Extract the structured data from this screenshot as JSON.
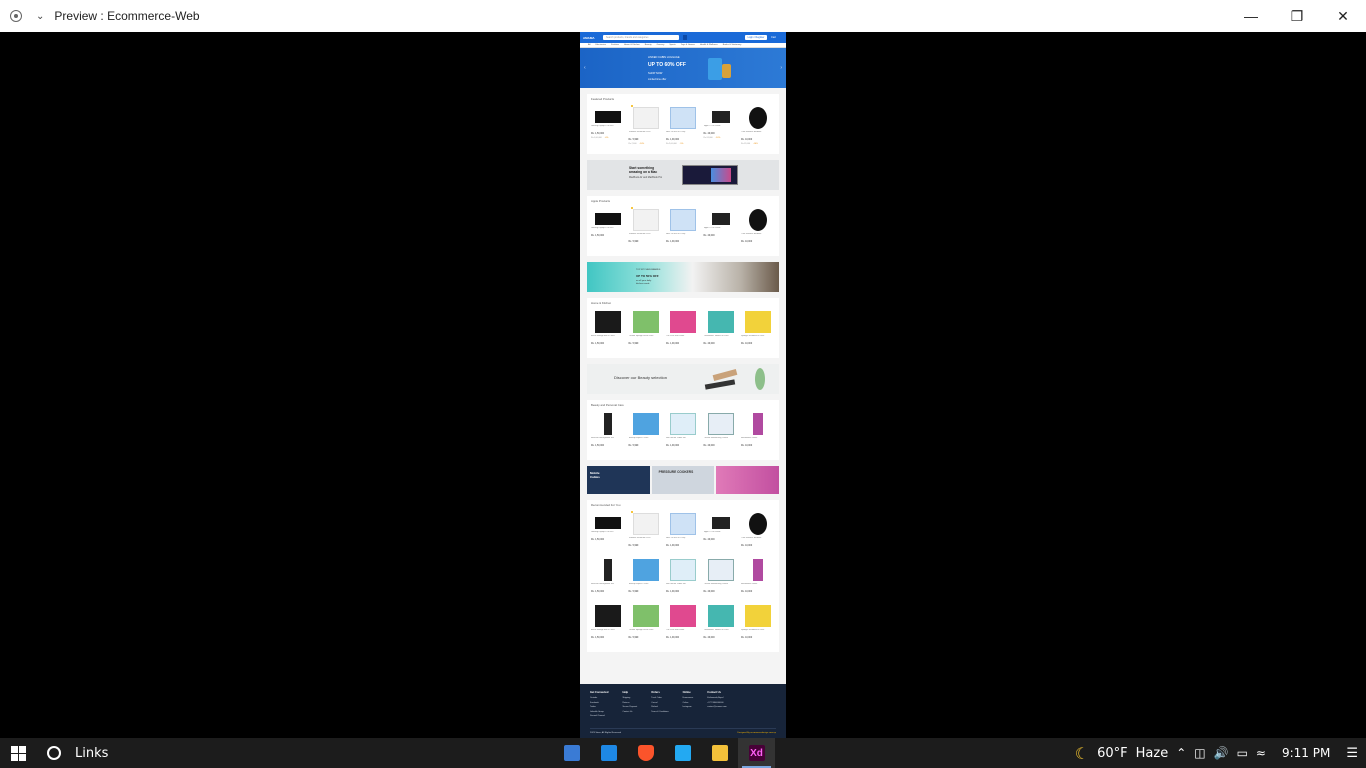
{
  "window": {
    "title": "Preview : Ecommerce-Web"
  },
  "site": {
    "logo": "AMAMA",
    "search_placeholder": "Search products, brands and categories",
    "login": "Login / Register",
    "cart": "Cart",
    "nav": [
      "All",
      "Electronics",
      "Fashion",
      "Home & Kitchen",
      "Beauty",
      "Grocery",
      "Sports",
      "Toys & Games",
      "Health & Wellness",
      "Books & Stationery"
    ],
    "hero": {
      "line1": "LINKED CABIN LUGGAGE",
      "line2": "UP TO 60% OFF",
      "line3": "SHOP NOW",
      "line4": "Limited time offer"
    },
    "sections": [
      {
        "title": "Featured Products",
        "rows": [
          [
            {
              "name": "Gaming Laptop 15.6 inch",
              "price": "Rs. 1,50,000",
              "old": "Rs.1,60,000",
              "off": "-6%"
            },
            {
              "name": "Wireless Router AC1200",
              "price": "Rs. 5,999",
              "old": "Rs.7,000",
              "off": "-14%"
            },
            {
              "name": "iMac 24 inch M1 Chip",
              "price": "Rs. 1,90,000",
              "old": "Rs.2,00,000",
              "off": "-5%"
            },
            {
              "name": "Apple TV 4K 64GB",
              "price": "Rs. 20,000",
              "old": "Rs.24,000",
              "off": "-16%"
            },
            {
              "name": "True Wireless Earbuds",
              "price": "Rs. 10,000",
              "old": "Rs.12,000",
              "off": "-16%"
            }
          ]
        ]
      },
      {
        "title": "Apple Products",
        "rows": [
          [
            {
              "name": "Gaming Laptop 15.6 inch",
              "price": "Rs. 1,50,000"
            },
            {
              "name": "Wireless Router AC1200",
              "price": "Rs. 5,999"
            },
            {
              "name": "iMac 24 inch M1 Chip",
              "price": "Rs. 1,90,000"
            },
            {
              "name": "Apple TV 4K 64GB",
              "price": "Rs. 20,000"
            },
            {
              "name": "True Wireless Earbuds",
              "price": "Rs. 10,000"
            }
          ]
        ]
      },
      {
        "title": "Home & Kitchen",
        "rows": [
          [
            {
              "name": "Black Storage Box 3 Piece",
              "price": "Rs. 1,50,000"
            },
            {
              "name": "Kitchen Sponge Scrub Pack",
              "price": "Rs. 5,999"
            },
            {
              "name": "The Pink Stuff Paste",
              "price": "Rs. 1,90,000"
            },
            {
              "name": "Dishwasher Tablets 40 Pack",
              "price": "Rs. 20,000"
            },
            {
              "name": "Sponge Scrubbers 6 Pack",
              "price": "Rs. 10,000"
            }
          ]
        ]
      },
      {
        "title": "Beauty and Personal Care",
        "rows": [
          [
            {
              "name": "Mascara and Eyeliner Set",
              "price": "Rs. 1,50,000"
            },
            {
              "name": "Makeup Wipes 3 Pack",
              "price": "Rs. 5,999"
            },
            {
              "name": "Hair Serum Tubes Set",
              "price": "Rs. 1,90,000"
            },
            {
              "name": "CeraVe Moisturising Cream",
              "price": "Rs. 20,000"
            },
            {
              "name": "Mouthwash 500ml",
              "price": "Rs. 10,000"
            }
          ]
        ]
      },
      {
        "title": "Recommended For You",
        "rows": [
          [
            {
              "name": "Gaming Laptop 15.6 inch",
              "price": "Rs. 1,50,000"
            },
            {
              "name": "Wireless Router AC1200",
              "price": "Rs. 5,999"
            },
            {
              "name": "iMac 24 inch M1 Chip",
              "price": "Rs. 1,90,000"
            },
            {
              "name": "Apple TV 4K 64GB",
              "price": "Rs. 20,000"
            },
            {
              "name": "True Wireless Earbuds",
              "price": "Rs. 10,000"
            }
          ],
          [
            {
              "name": "Mascara and Eyeliner Set",
              "price": "Rs. 1,50,000"
            },
            {
              "name": "Makeup Wipes 3 Pack",
              "price": "Rs. 5,999"
            },
            {
              "name": "Hair Serum Tubes Set",
              "price": "Rs. 1,90,000"
            },
            {
              "name": "CeraVe Moisturising Cream",
              "price": "Rs. 20,000"
            },
            {
              "name": "Mouthwash 500ml",
              "price": "Rs. 10,000"
            }
          ],
          [
            {
              "name": "Black Storage Box 3 Piece",
              "price": "Rs. 1,50,000"
            },
            {
              "name": "Kitchen Sponge Scrub Pack",
              "price": "Rs. 5,999"
            },
            {
              "name": "The Pink Stuff Paste",
              "price": "Rs. 1,90,000"
            },
            {
              "name": "Dishwasher Tablets 40 Pack",
              "price": "Rs. 20,000"
            },
            {
              "name": "Sponge Scrubbers 6 Pack",
              "price": "Rs. 10,000"
            }
          ]
        ]
      }
    ],
    "banner_mac": {
      "head1": "Start something",
      "head2": "amazing on a Mac",
      "sub": "MacBook Air and MacBook Pro"
    },
    "banner_kitchen": {
      "k1": "TOP KITCHEN BRANDS",
      "k2": "UP TO 50% OFF",
      "k3a": "on all your daily",
      "k3b": "kitchen needs"
    },
    "banner_beauty": {
      "text": "Discover our Beauty selection"
    },
    "tri": {
      "c1": "Mobile",
      "c1b": "Cables",
      "c2": "PRESSURE COOKERS"
    },
    "footer": {
      "cols": [
        {
          "h": "Get Connected",
          "items": [
            "Youtube",
            "Facebook",
            "Twitter",
            "LinkedIn Group",
            "Discord Channel"
          ]
        },
        {
          "h": "Help",
          "items": [
            "Shipping",
            "Returns",
            "Secure Payment",
            "Contact Us"
          ]
        },
        {
          "h": "Orders",
          "items": [
            "Track Order",
            "Cancel",
            "Refund",
            "Terms & Conditions"
          ]
        },
        {
          "h": "Online",
          "items": [
            "Ecommerce",
            "Online",
            "Instagram"
          ]
        },
        {
          "h": "Contact Us",
          "items": [
            "Kathmandu,Nepal",
            "+977 9800000000",
            "contact@ecomm.com"
          ]
        }
      ],
      "copy": "2023 Store, All Rights Reserved",
      "credit_prefix": "Designed By",
      "credit_name": "ecommercedesign.com.np"
    }
  },
  "taskbar": {
    "search_label": "Links",
    "weather": "60°F",
    "weather_desc": "Haze",
    "time": "9:11 PM"
  }
}
